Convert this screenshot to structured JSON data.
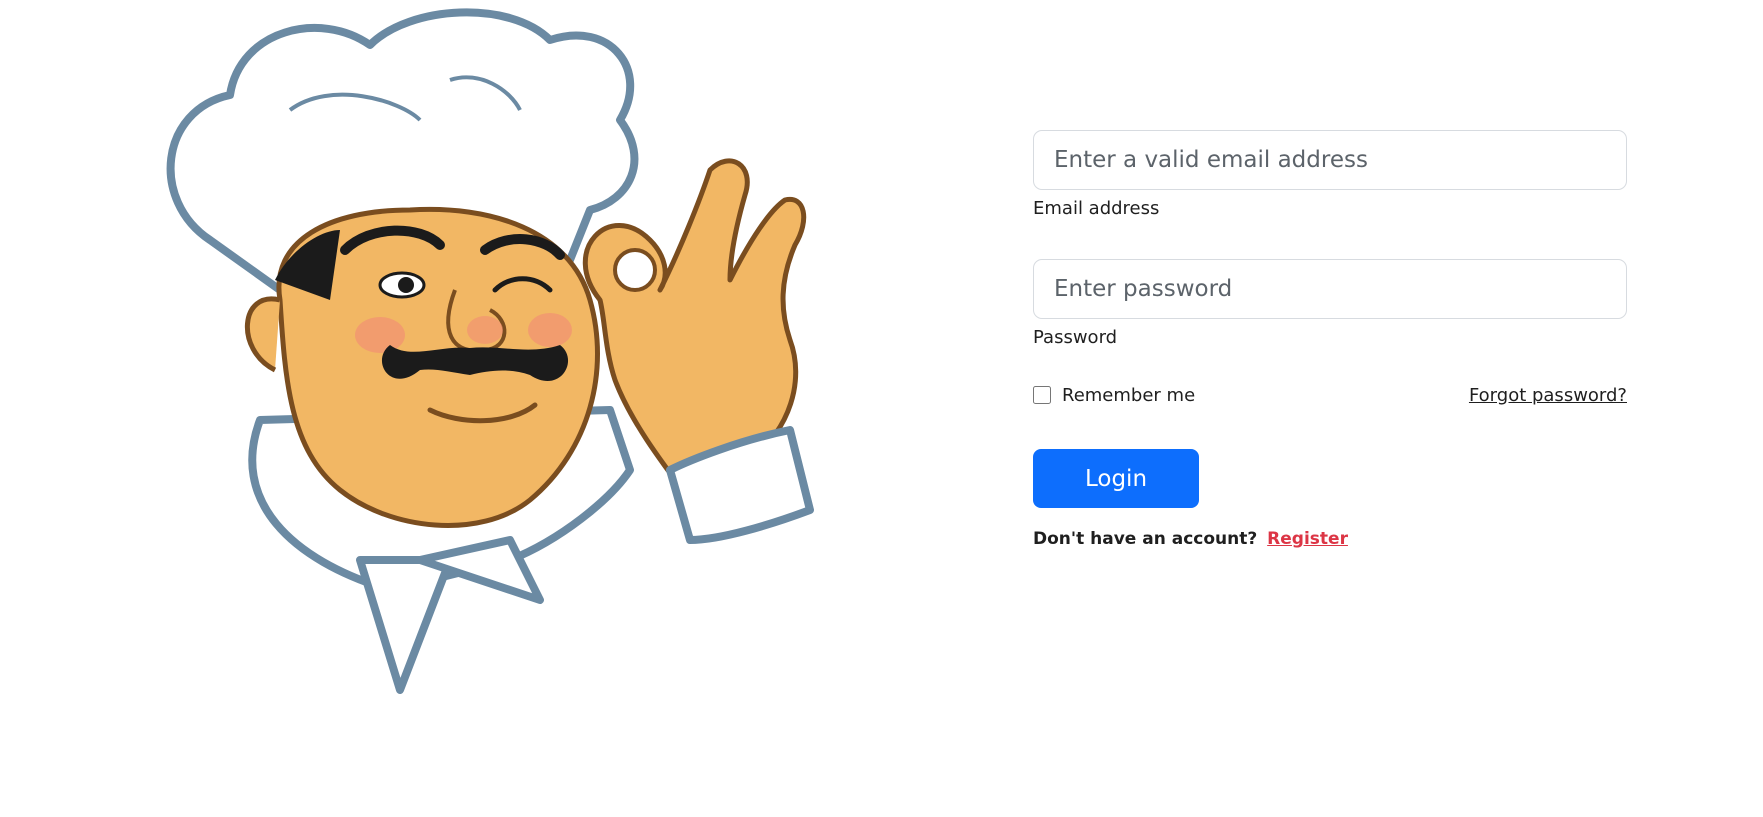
{
  "login_form": {
    "email": {
      "placeholder": "Enter a valid email address",
      "value": "",
      "label": "Email address"
    },
    "password": {
      "placeholder": "Enter password",
      "value": "",
      "label": "Password"
    },
    "remember_label": "Remember me",
    "remember_checked": false,
    "forgot_link": "Forgot password?",
    "login_button": "Login",
    "signup_prompt": "Don't have an account?",
    "register_link": "Register"
  },
  "illustration": {
    "icon": "chef-ok-gesture-illustration"
  },
  "colors": {
    "primary": "#0d6efd",
    "danger": "#dc3545",
    "chef_outline": "#6b8aa3",
    "chef_skin": "#f2b764"
  }
}
